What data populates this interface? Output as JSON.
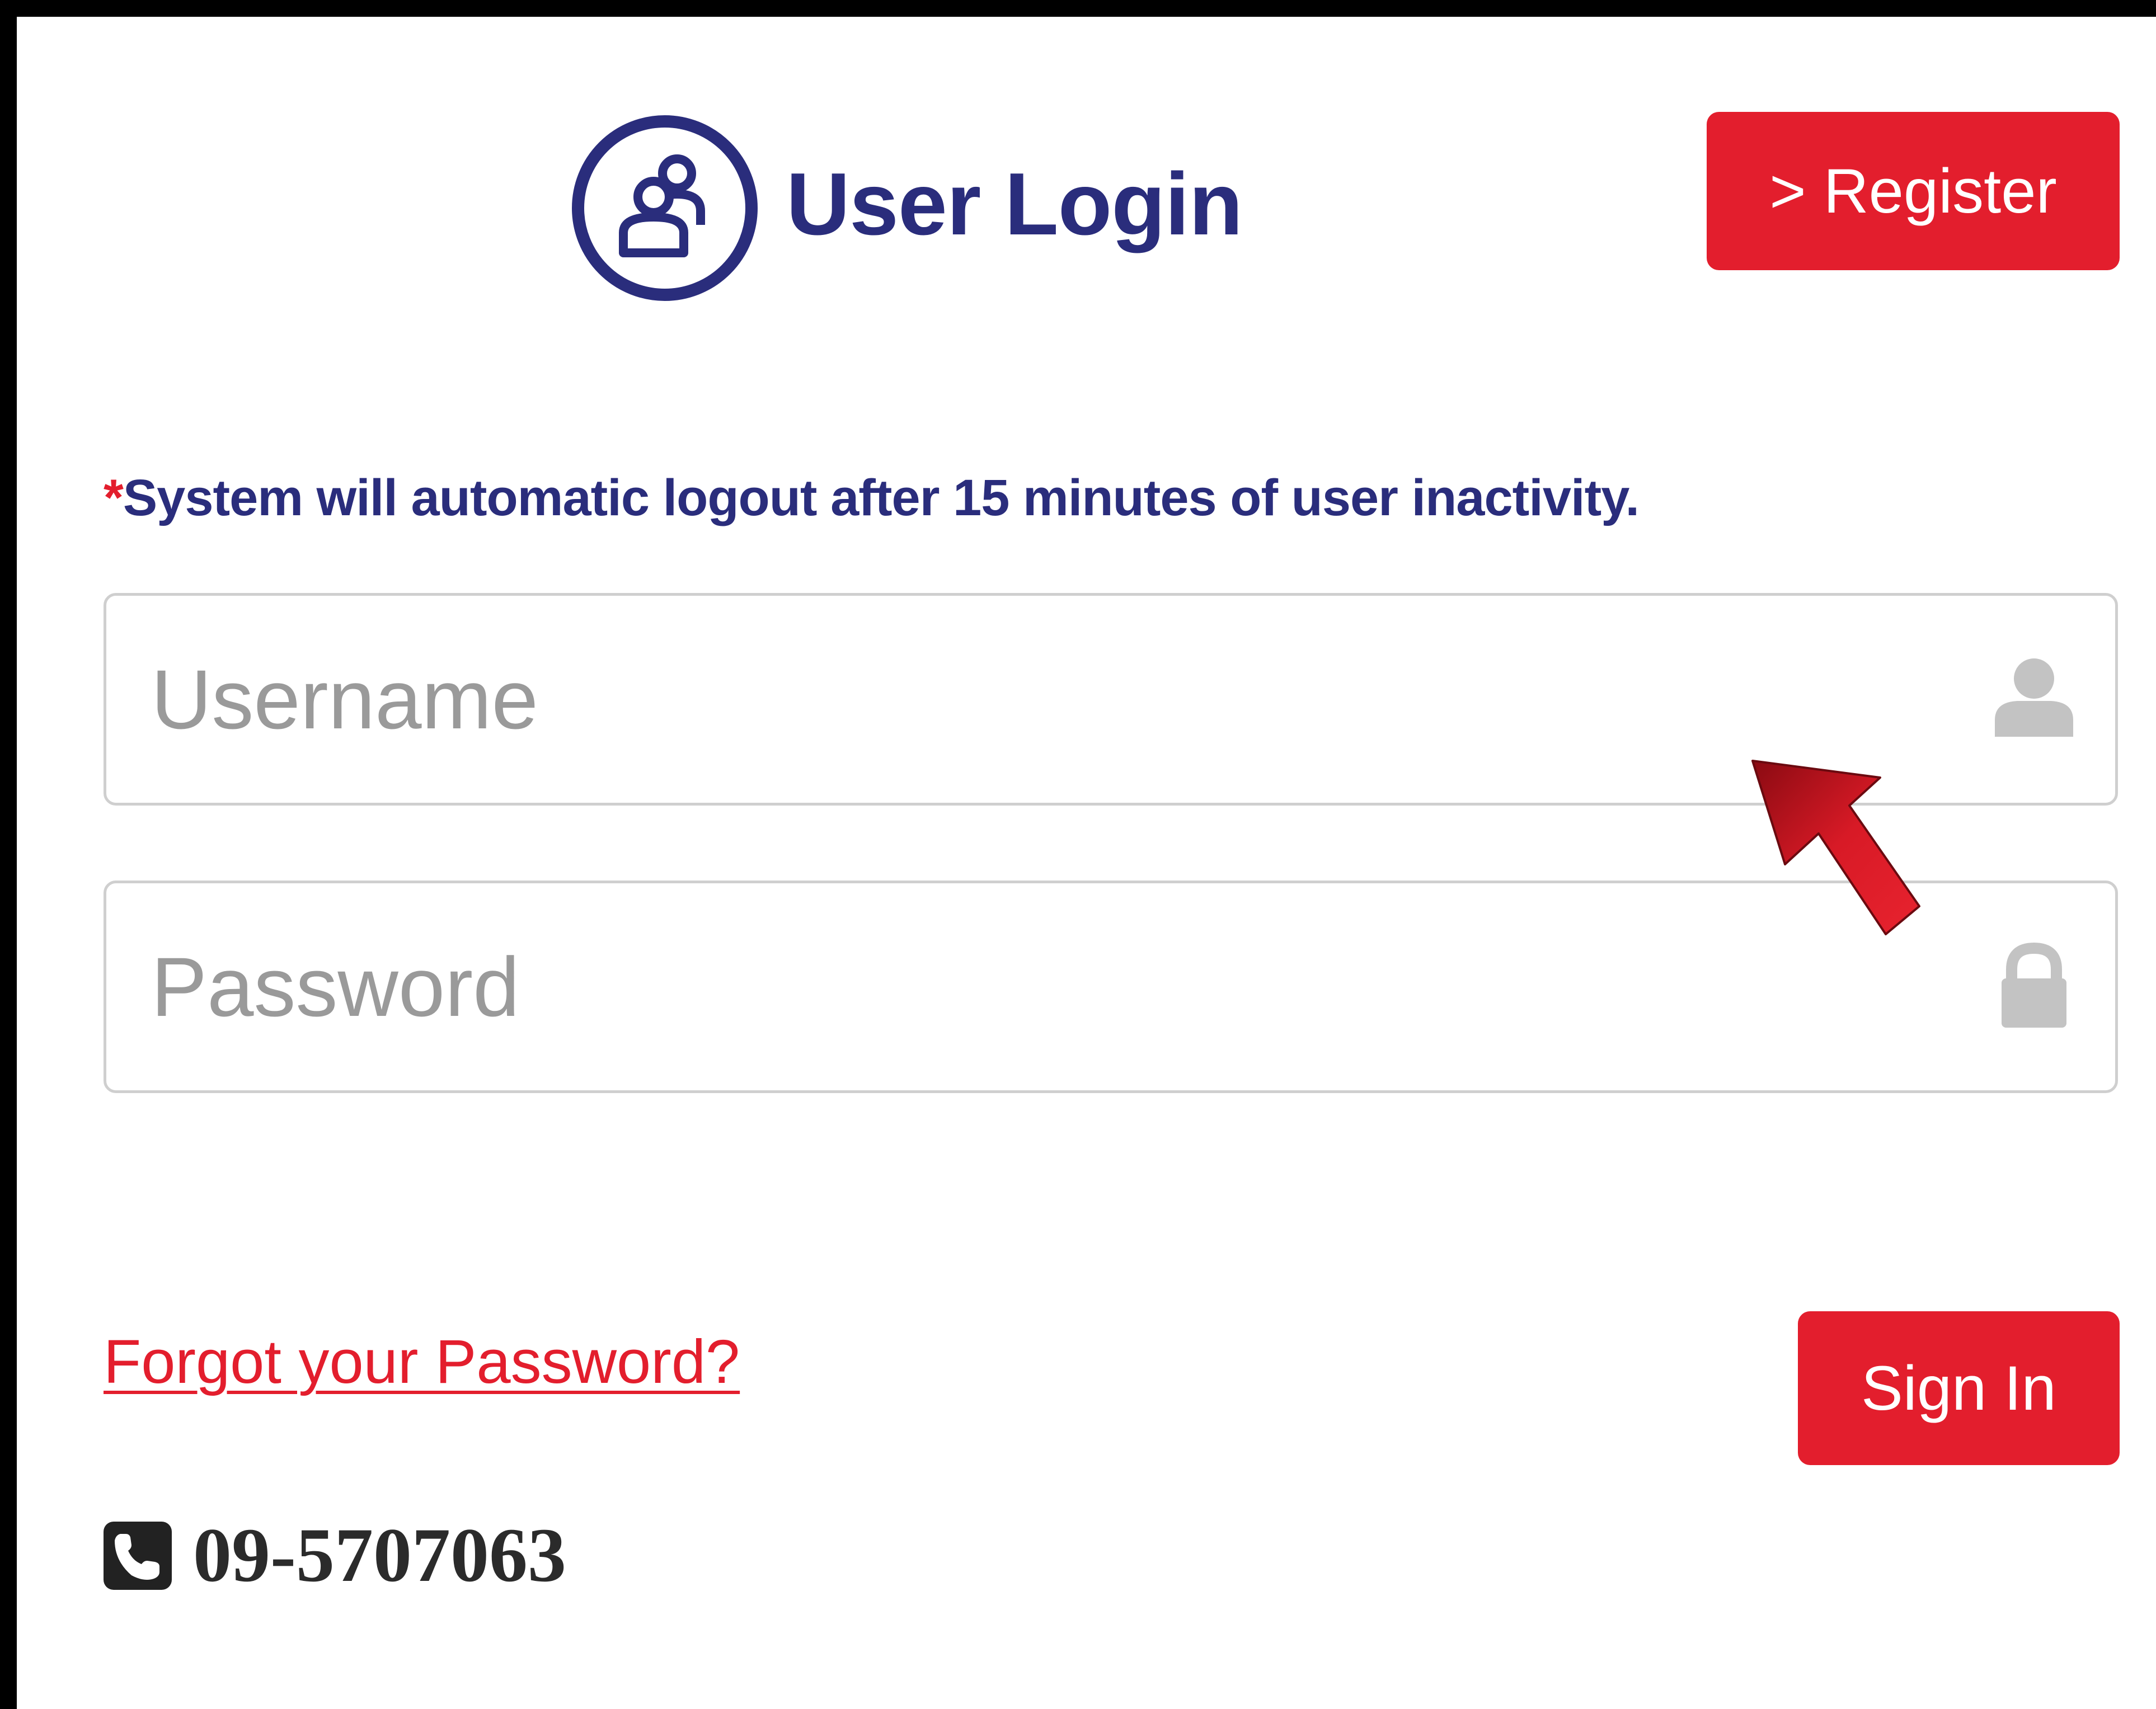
{
  "header": {
    "title": "User Login",
    "logo_icon": "user-group-icon",
    "register_label": "> Register"
  },
  "notice": {
    "star": "*",
    "text": "System will automatic logout after 15 minutes of user inactivity."
  },
  "form": {
    "username": {
      "placeholder": "Username",
      "value": "",
      "icon": "user-icon"
    },
    "password": {
      "placeholder": "Password",
      "value": "",
      "icon": "lock-icon"
    },
    "forgot_label": "Forgot your Password?",
    "signin_label": "Sign In"
  },
  "contact": {
    "icon": "phone-icon",
    "phone": "09-5707063"
  },
  "annotation": {
    "icon": "red-arrow-icon"
  },
  "colors": {
    "accent": "#e31e2d",
    "title": "#2a2d7c",
    "border": "#cfcfcf",
    "placeholder": "#9a9a9a",
    "frame": "#000000"
  }
}
